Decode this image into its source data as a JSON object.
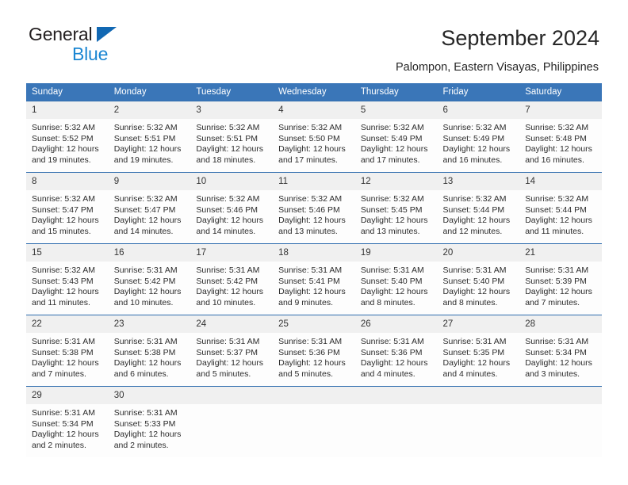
{
  "brand": {
    "line1": "General",
    "line2": "Blue",
    "triangle_color": "#1268b3",
    "line2_color": "#1b86d2"
  },
  "header": {
    "title": "September 2024",
    "subtitle": "Palompon, Eastern Visayas, Philippines"
  },
  "theme": {
    "header_bg": "#3a76b8",
    "row_divider": "#2f6dae",
    "daynum_bg": "#f0f0f0",
    "cell_bg": "#fdfdfd"
  },
  "weekdays": [
    "Sunday",
    "Monday",
    "Tuesday",
    "Wednesday",
    "Thursday",
    "Friday",
    "Saturday"
  ],
  "weeks": [
    [
      {
        "day": "1",
        "sunrise": "Sunrise: 5:32 AM",
        "sunset": "Sunset: 5:52 PM",
        "daylight": "Daylight: 12 hours and 19 minutes."
      },
      {
        "day": "2",
        "sunrise": "Sunrise: 5:32 AM",
        "sunset": "Sunset: 5:51 PM",
        "daylight": "Daylight: 12 hours and 19 minutes."
      },
      {
        "day": "3",
        "sunrise": "Sunrise: 5:32 AM",
        "sunset": "Sunset: 5:51 PM",
        "daylight": "Daylight: 12 hours and 18 minutes."
      },
      {
        "day": "4",
        "sunrise": "Sunrise: 5:32 AM",
        "sunset": "Sunset: 5:50 PM",
        "daylight": "Daylight: 12 hours and 17 minutes."
      },
      {
        "day": "5",
        "sunrise": "Sunrise: 5:32 AM",
        "sunset": "Sunset: 5:49 PM",
        "daylight": "Daylight: 12 hours and 17 minutes."
      },
      {
        "day": "6",
        "sunrise": "Sunrise: 5:32 AM",
        "sunset": "Sunset: 5:49 PM",
        "daylight": "Daylight: 12 hours and 16 minutes."
      },
      {
        "day": "7",
        "sunrise": "Sunrise: 5:32 AM",
        "sunset": "Sunset: 5:48 PM",
        "daylight": "Daylight: 12 hours and 16 minutes."
      }
    ],
    [
      {
        "day": "8",
        "sunrise": "Sunrise: 5:32 AM",
        "sunset": "Sunset: 5:47 PM",
        "daylight": "Daylight: 12 hours and 15 minutes."
      },
      {
        "day": "9",
        "sunrise": "Sunrise: 5:32 AM",
        "sunset": "Sunset: 5:47 PM",
        "daylight": "Daylight: 12 hours and 14 minutes."
      },
      {
        "day": "10",
        "sunrise": "Sunrise: 5:32 AM",
        "sunset": "Sunset: 5:46 PM",
        "daylight": "Daylight: 12 hours and 14 minutes."
      },
      {
        "day": "11",
        "sunrise": "Sunrise: 5:32 AM",
        "sunset": "Sunset: 5:46 PM",
        "daylight": "Daylight: 12 hours and 13 minutes."
      },
      {
        "day": "12",
        "sunrise": "Sunrise: 5:32 AM",
        "sunset": "Sunset: 5:45 PM",
        "daylight": "Daylight: 12 hours and 13 minutes."
      },
      {
        "day": "13",
        "sunrise": "Sunrise: 5:32 AM",
        "sunset": "Sunset: 5:44 PM",
        "daylight": "Daylight: 12 hours and 12 minutes."
      },
      {
        "day": "14",
        "sunrise": "Sunrise: 5:32 AM",
        "sunset": "Sunset: 5:44 PM",
        "daylight": "Daylight: 12 hours and 11 minutes."
      }
    ],
    [
      {
        "day": "15",
        "sunrise": "Sunrise: 5:32 AM",
        "sunset": "Sunset: 5:43 PM",
        "daylight": "Daylight: 12 hours and 11 minutes."
      },
      {
        "day": "16",
        "sunrise": "Sunrise: 5:31 AM",
        "sunset": "Sunset: 5:42 PM",
        "daylight": "Daylight: 12 hours and 10 minutes."
      },
      {
        "day": "17",
        "sunrise": "Sunrise: 5:31 AM",
        "sunset": "Sunset: 5:42 PM",
        "daylight": "Daylight: 12 hours and 10 minutes."
      },
      {
        "day": "18",
        "sunrise": "Sunrise: 5:31 AM",
        "sunset": "Sunset: 5:41 PM",
        "daylight": "Daylight: 12 hours and 9 minutes."
      },
      {
        "day": "19",
        "sunrise": "Sunrise: 5:31 AM",
        "sunset": "Sunset: 5:40 PM",
        "daylight": "Daylight: 12 hours and 8 minutes."
      },
      {
        "day": "20",
        "sunrise": "Sunrise: 5:31 AM",
        "sunset": "Sunset: 5:40 PM",
        "daylight": "Daylight: 12 hours and 8 minutes."
      },
      {
        "day": "21",
        "sunrise": "Sunrise: 5:31 AM",
        "sunset": "Sunset: 5:39 PM",
        "daylight": "Daylight: 12 hours and 7 minutes."
      }
    ],
    [
      {
        "day": "22",
        "sunrise": "Sunrise: 5:31 AM",
        "sunset": "Sunset: 5:38 PM",
        "daylight": "Daylight: 12 hours and 7 minutes."
      },
      {
        "day": "23",
        "sunrise": "Sunrise: 5:31 AM",
        "sunset": "Sunset: 5:38 PM",
        "daylight": "Daylight: 12 hours and 6 minutes."
      },
      {
        "day": "24",
        "sunrise": "Sunrise: 5:31 AM",
        "sunset": "Sunset: 5:37 PM",
        "daylight": "Daylight: 12 hours and 5 minutes."
      },
      {
        "day": "25",
        "sunrise": "Sunrise: 5:31 AM",
        "sunset": "Sunset: 5:36 PM",
        "daylight": "Daylight: 12 hours and 5 minutes."
      },
      {
        "day": "26",
        "sunrise": "Sunrise: 5:31 AM",
        "sunset": "Sunset: 5:36 PM",
        "daylight": "Daylight: 12 hours and 4 minutes."
      },
      {
        "day": "27",
        "sunrise": "Sunrise: 5:31 AM",
        "sunset": "Sunset: 5:35 PM",
        "daylight": "Daylight: 12 hours and 4 minutes."
      },
      {
        "day": "28",
        "sunrise": "Sunrise: 5:31 AM",
        "sunset": "Sunset: 5:34 PM",
        "daylight": "Daylight: 12 hours and 3 minutes."
      }
    ],
    [
      {
        "day": "29",
        "sunrise": "Sunrise: 5:31 AM",
        "sunset": "Sunset: 5:34 PM",
        "daylight": "Daylight: 12 hours and 2 minutes."
      },
      {
        "day": "30",
        "sunrise": "Sunrise: 5:31 AM",
        "sunset": "Sunset: 5:33 PM",
        "daylight": "Daylight: 12 hours and 2 minutes."
      },
      {
        "day": "",
        "sunrise": "",
        "sunset": "",
        "daylight": ""
      },
      {
        "day": "",
        "sunrise": "",
        "sunset": "",
        "daylight": ""
      },
      {
        "day": "",
        "sunrise": "",
        "sunset": "",
        "daylight": ""
      },
      {
        "day": "",
        "sunrise": "",
        "sunset": "",
        "daylight": ""
      },
      {
        "day": "",
        "sunrise": "",
        "sunset": "",
        "daylight": ""
      }
    ]
  ]
}
